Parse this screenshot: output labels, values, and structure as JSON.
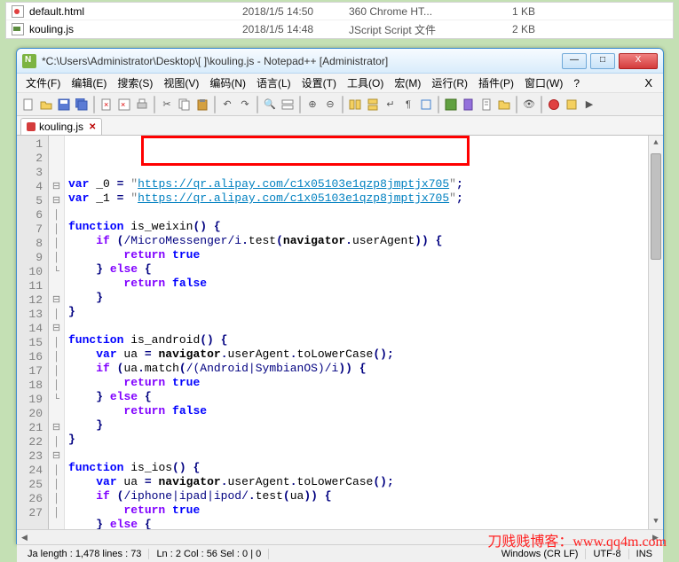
{
  "explorer": {
    "rows": [
      {
        "name": "default.html",
        "date": "2018/1/5 14:50",
        "type": "360 Chrome HT...",
        "size": "1 KB"
      },
      {
        "name": "kouling.js",
        "date": "2018/1/5 14:48",
        "type": "JScript Script 文件",
        "size": "2 KB"
      }
    ]
  },
  "window": {
    "title": "*C:\\Users\\Administrator\\Desktop\\[                    ]\\kouling.js - Notepad++ [Administrator]",
    "min": "—",
    "max": "□",
    "close": "X"
  },
  "menus": [
    "文件(F)",
    "编辑(E)",
    "搜索(S)",
    "视图(V)",
    "编码(N)",
    "语言(L)",
    "设置(T)",
    "工具(O)",
    "宏(M)",
    "运行(R)",
    "插件(P)",
    "窗口(W)",
    "?"
  ],
  "menu_x": "X",
  "tab": {
    "name": "kouling.js",
    "close": "✕"
  },
  "code": {
    "url1": "https://qr.alipay.com/c1x05103e1qzp8jmptjx705",
    "url2": "https://qr.alipay.com/c1x05103e1qzp8jmptjx705",
    "lines_shown": 27
  },
  "status": {
    "left": "Ja length : 1,478    lines : 73",
    "pos": "Ln : 2    Col : 56    Sel : 0 | 0",
    "eol": "Windows (CR LF)",
    "enc": "UTF-8",
    "mode": "INS"
  },
  "watermark": "刀贱贱博客：www.qq4m.com"
}
